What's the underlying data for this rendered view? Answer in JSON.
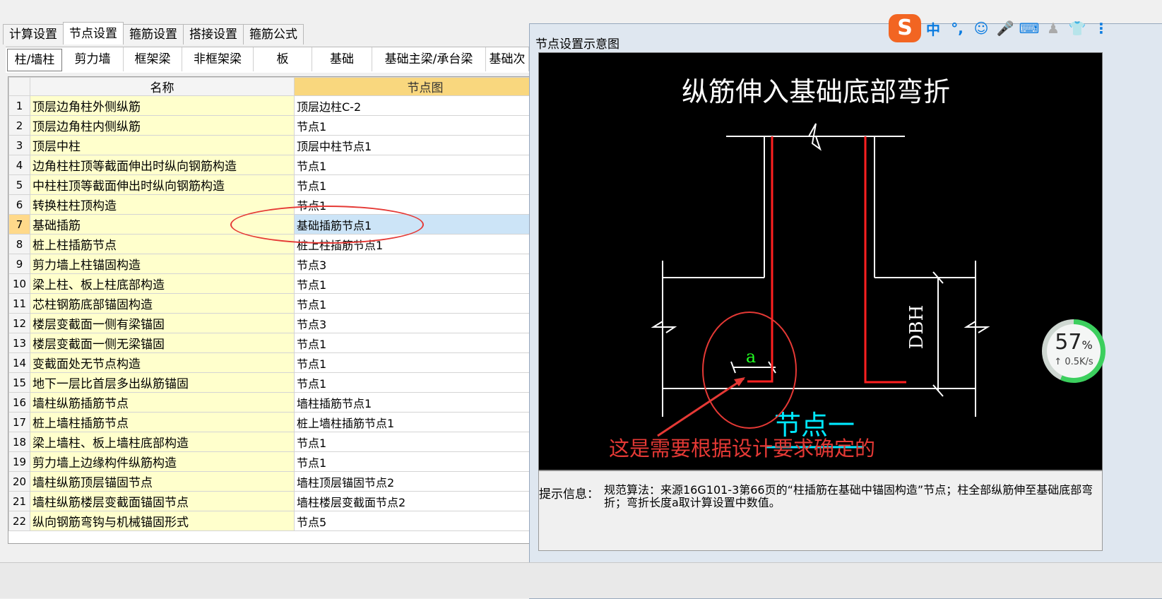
{
  "top_tabs": [
    "计算设置",
    "节点设置",
    "箍筋设置",
    "搭接设置",
    "箍筋公式"
  ],
  "sub_tabs": [
    "柱/墙柱",
    "剪力墙",
    "框架梁",
    "非框架梁",
    "板",
    "基础",
    "基础主梁/承台梁",
    "基础次"
  ],
  "table": {
    "headers": [
      "名称",
      "节点图"
    ],
    "rows": [
      {
        "num": "1",
        "name": "顶层边角柱外侧纵筋",
        "node": "顶层边柱C-2"
      },
      {
        "num": "2",
        "name": "顶层边角柱内侧纵筋",
        "node": "节点1"
      },
      {
        "num": "3",
        "name": "顶层中柱",
        "node": "顶层中柱节点1"
      },
      {
        "num": "4",
        "name": "边角柱柱顶等截面伸出时纵向钢筋构造",
        "node": "节点1"
      },
      {
        "num": "5",
        "name": "中柱柱顶等截面伸出时纵向钢筋构造",
        "node": "节点1"
      },
      {
        "num": "6",
        "name": "转换柱柱顶构造",
        "node": "节点1"
      },
      {
        "num": "7",
        "name": "基础插筋",
        "node": "基础插筋节点1"
      },
      {
        "num": "8",
        "name": "桩上柱插筋节点",
        "node": "桩上柱插筋节点1"
      },
      {
        "num": "9",
        "name": "剪力墙上柱锚固构造",
        "node": "节点3"
      },
      {
        "num": "10",
        "name": "梁上柱、板上柱底部构造",
        "node": "节点1"
      },
      {
        "num": "11",
        "name": "芯柱钢筋底部锚固构造",
        "node": "节点1"
      },
      {
        "num": "12",
        "name": "楼层变截面一侧有梁锚固",
        "node": "节点3"
      },
      {
        "num": "13",
        "name": "楼层变截面一侧无梁锚固",
        "node": "节点1"
      },
      {
        "num": "14",
        "name": "变截面处无节点构造",
        "node": "节点1"
      },
      {
        "num": "15",
        "name": "地下一层比首层多出纵筋锚固",
        "node": "节点1"
      },
      {
        "num": "16",
        "name": "墙柱纵筋插筋节点",
        "node": "墙柱插筋节点1"
      },
      {
        "num": "17",
        "name": "桩上墙柱插筋节点",
        "node": "桩上墙柱插筋节点1"
      },
      {
        "num": "18",
        "name": "梁上墙柱、板上墙柱底部构造",
        "node": "节点1"
      },
      {
        "num": "19",
        "name": "剪力墙上边缘构件纵筋构造",
        "node": "节点1"
      },
      {
        "num": "20",
        "name": "墙柱纵筋顶层锚固节点",
        "node": "墙柱顶层锚固节点2"
      },
      {
        "num": "21",
        "name": "墙柱纵筋楼层变截面锚固节点",
        "node": "墙柱楼层变截面节点2"
      },
      {
        "num": "22",
        "name": "纵向钢筋弯钩与机械锚固形式",
        "node": "节点5"
      }
    ]
  },
  "panel": {
    "title": "节点设置示意图",
    "diagram_title": "纵筋伸入基础底部弯折",
    "label_dbh": "DBH",
    "label_a": "a",
    "node_label": "节点一",
    "annotation": "这是需要根据设计要求确定的",
    "hint_label": "提示信息：",
    "hint_text": "规范算法：来源16G101-3第66页的“柱插筋在基础中锚固构造”节点；柱全部纵筋伸至基础底部弯折；弯折长度a取计算设置中数值。"
  },
  "ime": {
    "logo": "S",
    "items": [
      "中",
      "°,",
      "☺",
      "🎤",
      "⌨",
      "♟",
      "👕",
      "⋮"
    ]
  },
  "speed": {
    "percent": "57",
    "percent_unit": "%",
    "rate": "↑ 0.5K/s"
  },
  "colors": {
    "accent": "#ffd98a",
    "annotation": "#e53935",
    "rebar": "#ff2020",
    "node_label": "#00ffff"
  }
}
